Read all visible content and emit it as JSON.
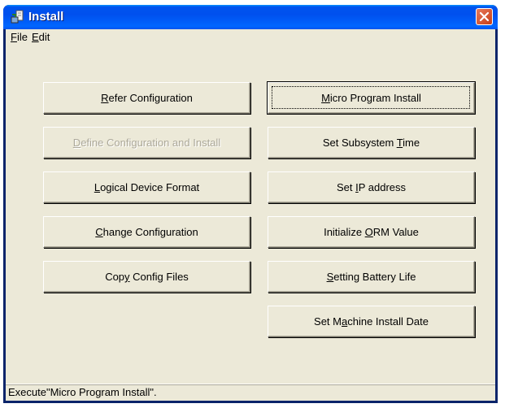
{
  "window": {
    "title": "Install",
    "title_icon": "install-icon"
  },
  "menu": {
    "file": {
      "accel": "F",
      "rest": "ile"
    },
    "edit": {
      "accel": "E",
      "rest": "dit"
    }
  },
  "buttons_left": [
    {
      "pre": "",
      "accel": "R",
      "post": "efer Configuration",
      "enabled": true
    },
    {
      "pre": "",
      "accel": "D",
      "post": "efine Configuration and Install",
      "enabled": false
    },
    {
      "pre": "",
      "accel": "L",
      "post": "ogical Device Format",
      "enabled": true
    },
    {
      "pre": "",
      "accel": "C",
      "post": "hange Configuration",
      "enabled": true
    },
    {
      "pre": "Cop",
      "accel": "y",
      "post": " Config Files",
      "enabled": true
    }
  ],
  "buttons_right": [
    {
      "pre": "",
      "accel": "M",
      "post": "icro Program Install",
      "enabled": true
    },
    {
      "pre": "Set Subsystem ",
      "accel": "T",
      "post": "ime",
      "enabled": true
    },
    {
      "pre": "Set ",
      "accel": "I",
      "post": "P address",
      "enabled": true
    },
    {
      "pre": "Initialize ",
      "accel": "O",
      "post": "RM Value",
      "enabled": true
    },
    {
      "pre": "",
      "accel": "S",
      "post": "etting Battery Life",
      "enabled": true
    },
    {
      "pre": "Set M",
      "accel": "a",
      "post": "chine Install Date",
      "enabled": true
    }
  ],
  "status": {
    "text": "Execute\"Micro Program Install\"."
  }
}
